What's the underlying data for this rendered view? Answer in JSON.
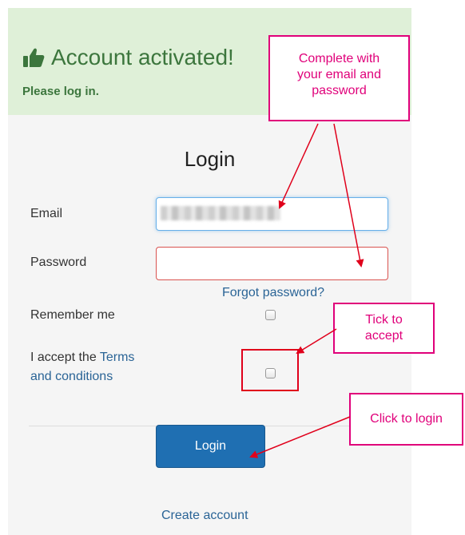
{
  "alert": {
    "title": "Account activated!",
    "subtitle": "Please log in."
  },
  "form": {
    "title": "Login",
    "email_label": "Email",
    "password_label": "Password",
    "forgot_password": "Forgot password?",
    "remember_me": "Remember me",
    "accept_prefix": "I accept the ",
    "terms_line1": "Terms",
    "terms_line2": "and conditions",
    "login_button": "Login",
    "create_account": "Create account"
  },
  "annotations": {
    "complete_line1": "Complete with",
    "complete_line2": "your email and",
    "complete_line3": "password",
    "tick_line1": "Tick to",
    "tick_line2": "accept",
    "click_login": "Click to login"
  },
  "colors": {
    "alert_bg": "#dff0d8",
    "alert_text": "#3c763d",
    "primary": "#1f6fb2",
    "link": "#2a6496",
    "annotation": "#e0007a",
    "arrow": "#e0001b"
  },
  "icons": [
    "thumbs-up-icon"
  ]
}
